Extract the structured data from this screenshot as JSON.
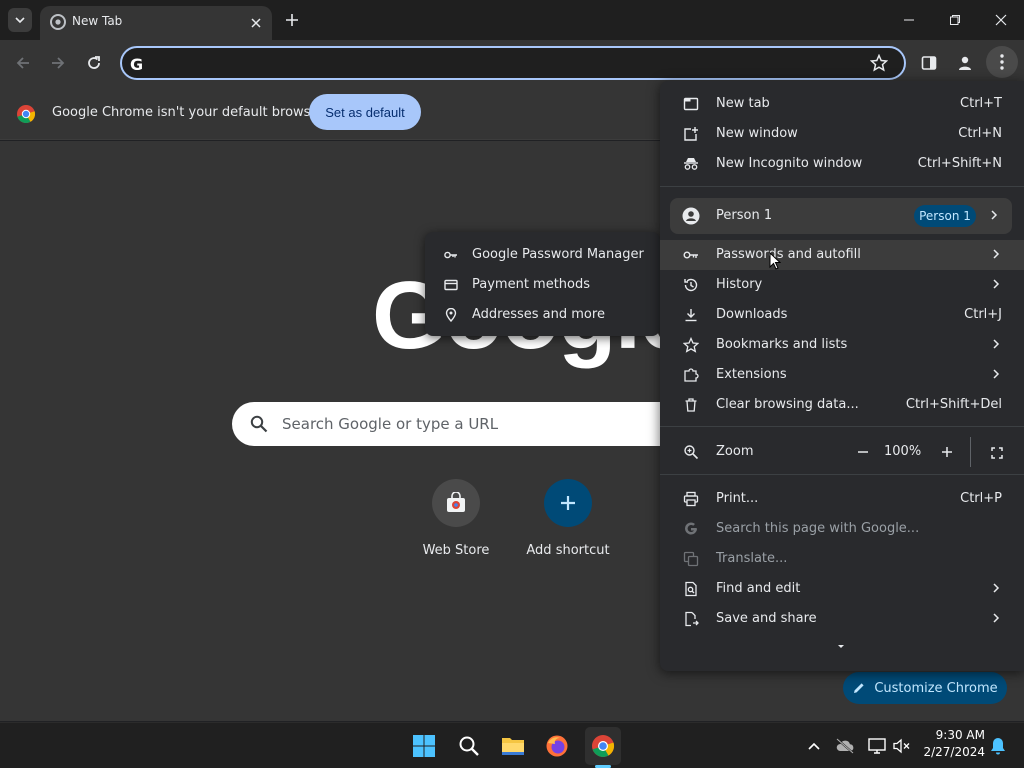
{
  "tabbar": {
    "tab_title": "New Tab"
  },
  "omnibox": {
    "placeholder": ""
  },
  "infobar": {
    "message": "Google Chrome isn't your default browser",
    "button": "Set as default"
  },
  "ntp": {
    "logo": "Google",
    "search_placeholder": "Search Google or type a URL",
    "shortcuts": [
      {
        "label": "Web Store"
      },
      {
        "label": "Add shortcut"
      }
    ],
    "customize": "Customize Chrome"
  },
  "menu": {
    "new_tab": {
      "label": "New tab",
      "shortcut": "Ctrl+T"
    },
    "new_window": {
      "label": "New window",
      "shortcut": "Ctrl+N"
    },
    "incognito": {
      "label": "New Incognito window",
      "shortcut": "Ctrl+Shift+N"
    },
    "person": {
      "label": "Person 1",
      "badge": "Person 1"
    },
    "passwords": {
      "label": "Passwords and autofill"
    },
    "history": {
      "label": "History"
    },
    "downloads": {
      "label": "Downloads",
      "shortcut": "Ctrl+J"
    },
    "bookmarks": {
      "label": "Bookmarks and lists"
    },
    "extensions": {
      "label": "Extensions"
    },
    "clear": {
      "label": "Clear browsing data...",
      "shortcut": "Ctrl+Shift+Del"
    },
    "zoom": {
      "label": "Zoom",
      "value": "100%"
    },
    "print": {
      "label": "Print...",
      "shortcut": "Ctrl+P"
    },
    "search_page": {
      "label": "Search this page with Google..."
    },
    "translate": {
      "label": "Translate..."
    },
    "find": {
      "label": "Find and edit"
    },
    "save": {
      "label": "Save and share"
    }
  },
  "submenu": {
    "items": [
      {
        "label": "Google Password Manager"
      },
      {
        "label": "Payment methods"
      },
      {
        "label": "Addresses and more"
      }
    ]
  },
  "taskbar": {
    "time": "9:30 AM",
    "date": "2/27/2024"
  },
  "colors": {
    "accent": "#a8c7fa",
    "menu_bg": "#292a2d",
    "page_bg": "#353535"
  }
}
